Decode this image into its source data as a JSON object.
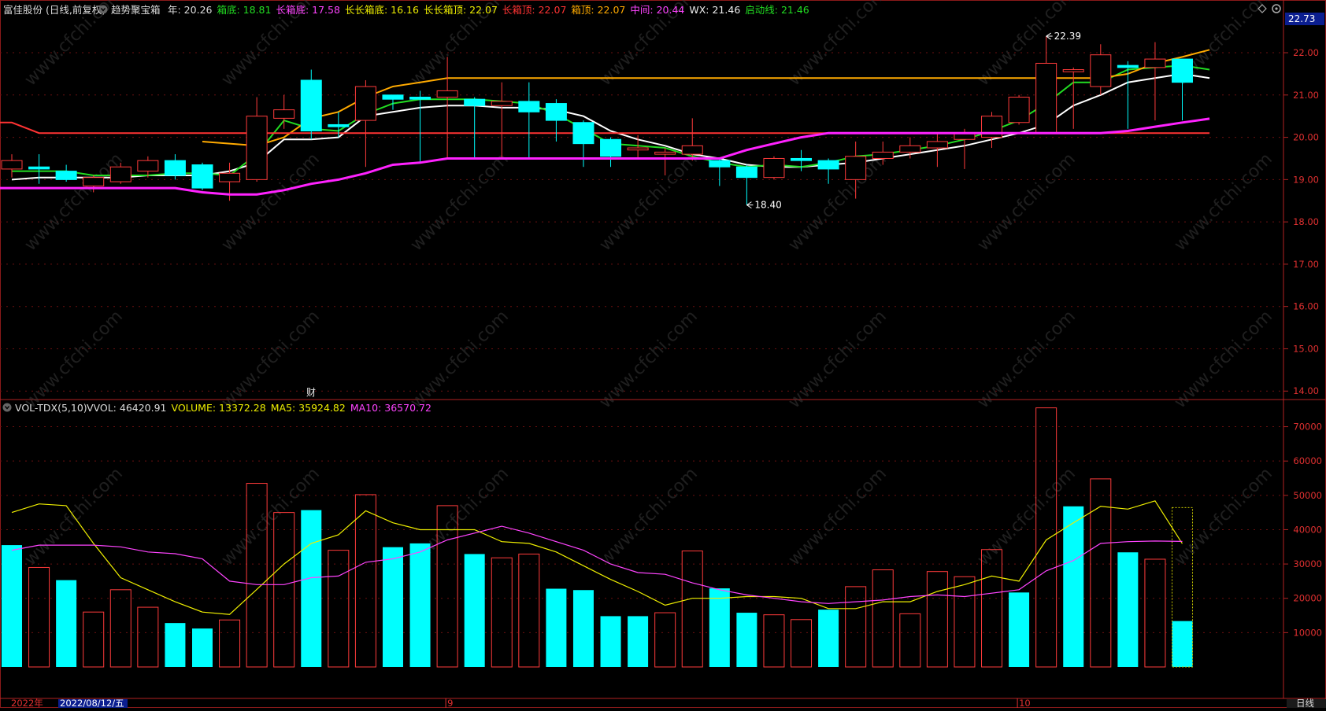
{
  "main_header": {
    "stock": "富佳股份 (日线,前复权)",
    "indicator": "趋势聚宝箱",
    "items": [
      {
        "label": "年: 20.26",
        "color": "#dddddd"
      },
      {
        "label": "箱底: 18.81",
        "color": "#22dd22"
      },
      {
        "label": "长箱底: 17.58",
        "color": "#ff44ff"
      },
      {
        "label": "长长箱底: 16.16",
        "color": "#eeee00"
      },
      {
        "label": "长长箱顶: 22.07",
        "color": "#eeee00"
      },
      {
        "label": "长箱顶: 22.07",
        "color": "#ff3333"
      },
      {
        "label": "箱顶: 22.07",
        "color": "#ffaa00"
      },
      {
        "label": "中间: 20.44",
        "color": "#ff44ff"
      },
      {
        "label": "WX: 21.46",
        "color": "#eeeeee"
      },
      {
        "label": "启动线: 21.46",
        "color": "#22dd22"
      }
    ]
  },
  "volume_header": {
    "indicator": "VOL-TDX(5,10)",
    "items": [
      {
        "label": "VVOL: 46420.91",
        "color": "#dddddd"
      },
      {
        "label": "VOLUME: 13372.28",
        "color": "#eeee00"
      },
      {
        "label": "MA5: 35924.82",
        "color": "#eeee00"
      },
      {
        "label": "MA10: 36570.72",
        "color": "#ff44ff"
      }
    ]
  },
  "price_box": "22.73",
  "cursor_date": "2022/08/12/五",
  "period_label": "日线",
  "finance_marker": "财",
  "annotations": {
    "high": "22.39",
    "low": "18.40"
  },
  "chart_data": [
    {
      "type": "candlestick",
      "ylim": [
        13.8,
        22.8
      ],
      "y_ticks": [
        "22.00",
        "21.00",
        "20.00",
        "19.00",
        "18.00",
        "17.00",
        "16.00",
        "15.00",
        "14.00"
      ],
      "x_markers": [
        "2022年",
        "9",
        "10"
      ],
      "candles": [
        {
          "o": 19.25,
          "c": 19.45,
          "h": 19.6,
          "l": 19.05
        },
        {
          "o": 19.3,
          "c": 19.25,
          "h": 19.6,
          "l": 18.9
        },
        {
          "o": 19.2,
          "c": 19.0,
          "h": 19.35,
          "l": 18.95
        },
        {
          "o": 18.85,
          "c": 19.05,
          "h": 19.1,
          "l": 18.7
        },
        {
          "o": 18.95,
          "c": 19.3,
          "h": 19.4,
          "l": 18.9
        },
        {
          "o": 19.2,
          "c": 19.45,
          "h": 19.55,
          "l": 19.05
        },
        {
          "o": 19.45,
          "c": 19.1,
          "h": 19.6,
          "l": 19.0
        },
        {
          "o": 19.35,
          "c": 18.8,
          "h": 19.4,
          "l": 18.75
        },
        {
          "o": 18.95,
          "c": 19.15,
          "h": 19.4,
          "l": 18.5
        },
        {
          "o": 19.0,
          "c": 20.5,
          "h": 20.95,
          "l": 18.95
        },
        {
          "o": 20.45,
          "c": 20.65,
          "h": 21.0,
          "l": 20.2
        },
        {
          "o": 21.35,
          "c": 20.15,
          "h": 21.6,
          "l": 19.95
        },
        {
          "o": 20.3,
          "c": 20.25,
          "h": 20.6,
          "l": 20.0
        },
        {
          "o": 20.4,
          "c": 21.2,
          "h": 21.35,
          "l": 19.3
        },
        {
          "o": 21.0,
          "c": 20.9,
          "h": 21.0,
          "l": 20.65
        },
        {
          "o": 20.95,
          "c": 20.9,
          "h": 21.1,
          "l": 19.4
        },
        {
          "o": 20.95,
          "c": 21.1,
          "h": 21.9,
          "l": 19.5
        },
        {
          "o": 20.9,
          "c": 20.75,
          "h": 20.95,
          "l": 19.5
        },
        {
          "o": 20.75,
          "c": 20.85,
          "h": 21.3,
          "l": 19.5
        },
        {
          "o": 20.85,
          "c": 20.6,
          "h": 21.3,
          "l": 19.5
        },
        {
          "o": 20.8,
          "c": 20.4,
          "h": 20.9,
          "l": 19.9
        },
        {
          "o": 20.35,
          "c": 19.85,
          "h": 20.4,
          "l": 19.3
        },
        {
          "o": 19.95,
          "c": 19.55,
          "h": 20.0,
          "l": 19.3
        },
        {
          "o": 19.7,
          "c": 19.75,
          "h": 20.05,
          "l": 19.5
        },
        {
          "o": 19.6,
          "c": 19.65,
          "h": 19.75,
          "l": 19.1
        },
        {
          "o": 19.6,
          "c": 19.8,
          "h": 20.45,
          "l": 19.45
        },
        {
          "o": 19.45,
          "c": 19.3,
          "h": 19.5,
          "l": 18.85
        },
        {
          "o": 19.3,
          "c": 19.05,
          "h": 19.35,
          "l": 18.4
        },
        {
          "o": 19.05,
          "c": 19.5,
          "h": 19.55,
          "l": 19.0
        },
        {
          "o": 19.5,
          "c": 19.45,
          "h": 19.7,
          "l": 19.2
        },
        {
          "o": 19.45,
          "c": 19.25,
          "h": 19.5,
          "l": 18.9
        },
        {
          "o": 19.0,
          "c": 19.55,
          "h": 19.9,
          "l": 18.55
        },
        {
          "o": 19.5,
          "c": 19.65,
          "h": 19.9,
          "l": 19.35
        },
        {
          "o": 19.65,
          "c": 19.8,
          "h": 20.0,
          "l": 19.5
        },
        {
          "o": 19.75,
          "c": 19.9,
          "h": 20.1,
          "l": 19.3
        },
        {
          "o": 19.95,
          "c": 20.1,
          "h": 20.2,
          "l": 19.25
        },
        {
          "o": 20.0,
          "c": 20.5,
          "h": 20.6,
          "l": 19.75
        },
        {
          "o": 20.35,
          "c": 20.95,
          "h": 21.0,
          "l": 20.3
        },
        {
          "o": 20.1,
          "c": 21.75,
          "h": 22.39,
          "l": 20.1
        },
        {
          "o": 21.55,
          "c": 21.6,
          "h": 21.65,
          "l": 20.2
        },
        {
          "o": 21.2,
          "c": 21.95,
          "h": 22.2,
          "l": 21.0
        },
        {
          "o": 21.7,
          "c": 21.65,
          "h": 21.8,
          "l": 20.2
        },
        {
          "o": 21.65,
          "c": 21.85,
          "h": 22.25,
          "l": 20.4
        },
        {
          "o": 21.85,
          "c": 21.3,
          "h": 21.85,
          "l": 20.4
        }
      ],
      "series": [
        {
          "key": "white_line",
          "color": "#ffffff",
          "values": [
            19.0,
            19.05,
            19.05,
            19.05,
            19.05,
            19.1,
            19.1,
            19.1,
            19.2,
            19.4,
            19.95,
            19.95,
            20.0,
            20.5,
            20.6,
            20.7,
            20.75,
            20.75,
            20.7,
            20.7,
            20.65,
            20.5,
            20.15,
            19.95,
            19.8,
            19.6,
            19.5,
            19.35,
            19.3,
            19.3,
            19.35,
            19.4,
            19.5,
            19.6,
            19.7,
            19.8,
            19.95,
            20.1,
            20.3,
            20.75,
            21.0,
            21.3,
            21.4,
            21.5,
            21.4
          ]
        },
        {
          "key": "green_line",
          "color": "#22dd22",
          "values": [
            19.2,
            19.2,
            19.2,
            19.1,
            19.1,
            19.1,
            19.15,
            19.15,
            19.1,
            19.6,
            20.4,
            20.2,
            20.15,
            20.55,
            20.8,
            20.9,
            20.9,
            20.9,
            20.85,
            20.8,
            20.55,
            20.2,
            19.85,
            19.8,
            19.75,
            19.55,
            19.4,
            19.3,
            19.35,
            19.3,
            19.4,
            19.55,
            19.6,
            19.7,
            19.8,
            19.95,
            20.15,
            20.4,
            20.8,
            21.3,
            21.3,
            21.6,
            21.65,
            21.7,
            21.6
          ]
        },
        {
          "key": "orange_line",
          "color": "#ffaa00",
          "values": [
            null,
            null,
            null,
            null,
            null,
            null,
            null,
            19.9,
            19.85,
            19.8,
            20.0,
            20.45,
            20.6,
            20.95,
            21.2,
            21.3,
            21.4,
            21.4,
            21.4,
            21.4,
            21.4,
            21.4,
            21.4,
            21.4,
            21.4,
            21.4,
            21.4,
            21.4,
            21.4,
            21.4,
            21.4,
            21.4,
            21.4,
            21.4,
            21.4,
            21.4,
            21.4,
            21.4,
            21.4,
            21.4,
            21.4,
            21.5,
            21.75,
            21.9,
            22.07
          ]
        },
        {
          "key": "red_line",
          "color": "#ff3333",
          "values": [
            20.35,
            20.1,
            20.1,
            20.1,
            20.1,
            20.1,
            20.1,
            20.1,
            20.1,
            20.1,
            20.1,
            20.1,
            20.1,
            20.1,
            20.1,
            20.1,
            20.1,
            20.1,
            20.1,
            20.1,
            20.1,
            20.1,
            20.1,
            20.1,
            20.1,
            20.1,
            20.1,
            20.1,
            20.1,
            20.1,
            20.1,
            20.1,
            20.1,
            20.1,
            20.1,
            20.1,
            20.1,
            20.1,
            20.1,
            20.1,
            20.1,
            20.1,
            20.1,
            20.1,
            20.1
          ]
        },
        {
          "key": "magenta_line",
          "color": "#ff22ff",
          "values": [
            18.8,
            18.8,
            18.8,
            18.8,
            18.8,
            18.8,
            18.8,
            18.7,
            18.65,
            18.65,
            18.75,
            18.9,
            19.0,
            19.15,
            19.35,
            19.4,
            19.5,
            19.5,
            19.5,
            19.5,
            19.5,
            19.5,
            19.5,
            19.5,
            19.5,
            19.5,
            19.5,
            19.7,
            19.85,
            20.0,
            20.1,
            20.1,
            20.1,
            20.1,
            20.1,
            20.1,
            20.1,
            20.1,
            20.1,
            20.1,
            20.1,
            20.15,
            20.25,
            20.35,
            20.44
          ]
        }
      ]
    },
    {
      "type": "bar",
      "ylim": [
        0,
        77000
      ],
      "y_ticks": [
        "70000",
        "60000",
        "50000",
        "40000",
        "30000",
        "20000",
        "10000"
      ],
      "values": [
        35500,
        29000,
        25300,
        16000,
        22500,
        17400,
        12800,
        11200,
        13700,
        53500,
        45000,
        45700,
        34000,
        50200,
        34900,
        36000,
        47000,
        32900,
        31800,
        32900,
        22800,
        22400,
        14800,
        14800,
        15800,
        33800,
        22900,
        15800,
        15200,
        13800,
        16700,
        23400,
        28300,
        15500,
        27800,
        26300,
        34200,
        21700,
        75500,
        46800,
        54800,
        33400,
        31400,
        13372
      ],
      "up_down": [
        "dn",
        "up",
        "dn",
        "up",
        "up",
        "up",
        "dn",
        "dn",
        "up",
        "up",
        "up",
        "dn",
        "up",
        "up",
        "dn",
        "dn",
        "up",
        "dn",
        "up",
        "up",
        "dn",
        "dn",
        "dn",
        "dn",
        "up",
        "up",
        "dn",
        "dn",
        "up",
        "up",
        "dn",
        "up",
        "up",
        "up",
        "up",
        "up",
        "up",
        "dn",
        "up",
        "dn",
        "up",
        "dn",
        "up",
        "dn"
      ],
      "series": [
        {
          "name": "MA5",
          "color": "#eeee00",
          "values": [
            45000,
            47500,
            47000,
            36000,
            26000,
            22500,
            19000,
            16000,
            15300,
            22600,
            30000,
            36000,
            38500,
            45500,
            42000,
            40000,
            40000,
            40000,
            36500,
            36000,
            33500,
            29500,
            25500,
            22000,
            18000,
            20000,
            20000,
            20500,
            20500,
            20000,
            17000,
            17000,
            19000,
            19000,
            22000,
            24000,
            26500,
            25000,
            37000,
            42000,
            46800,
            46000,
            48400,
            35924
          ]
        },
        {
          "name": "MA10",
          "color": "#ff44ff",
          "values": [
            34000,
            35500,
            35500,
            35500,
            35000,
            33500,
            33000,
            31500,
            25000,
            24000,
            24000,
            26000,
            26500,
            30500,
            31500,
            33500,
            37000,
            39000,
            41000,
            39000,
            36500,
            34000,
            30000,
            27500,
            27000,
            24500,
            22500,
            21000,
            20000,
            19000,
            18500,
            19000,
            19500,
            20500,
            21000,
            20500,
            21500,
            22500,
            28000,
            31000,
            36000,
            36500,
            36700,
            36570
          ]
        }
      ]
    }
  ]
}
